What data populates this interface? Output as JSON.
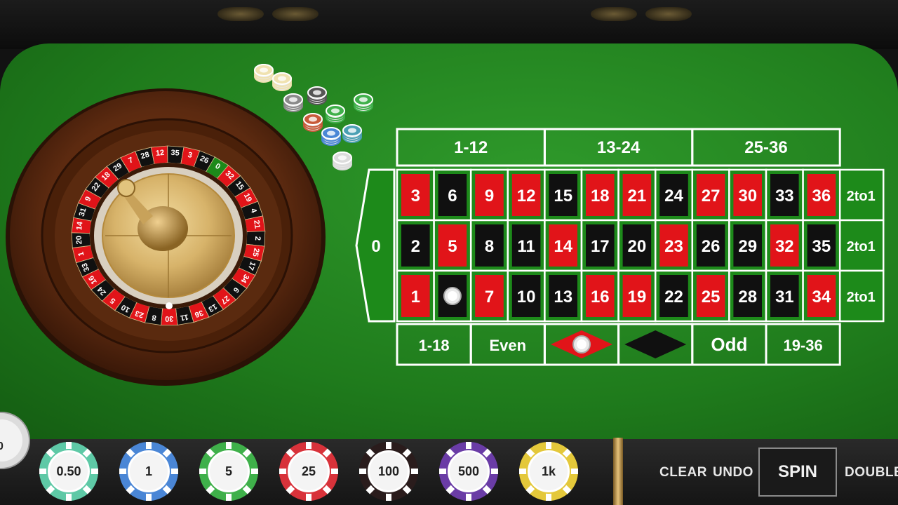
{
  "table": {
    "dozens": [
      "1-12",
      "13-24",
      "25-36"
    ],
    "zero": "0",
    "rows": [
      [
        {
          "n": "3",
          "c": "red"
        },
        {
          "n": "6",
          "c": "black"
        },
        {
          "n": "9",
          "c": "red"
        },
        {
          "n": "12",
          "c": "red"
        },
        {
          "n": "15",
          "c": "black"
        },
        {
          "n": "18",
          "c": "red"
        },
        {
          "n": "21",
          "c": "red"
        },
        {
          "n": "24",
          "c": "black"
        },
        {
          "n": "27",
          "c": "red"
        },
        {
          "n": "30",
          "c": "red"
        },
        {
          "n": "33",
          "c": "black"
        },
        {
          "n": "36",
          "c": "red"
        }
      ],
      [
        {
          "n": "2",
          "c": "black"
        },
        {
          "n": "5",
          "c": "red"
        },
        {
          "n": "8",
          "c": "black"
        },
        {
          "n": "11",
          "c": "black"
        },
        {
          "n": "14",
          "c": "red"
        },
        {
          "n": "17",
          "c": "black"
        },
        {
          "n": "20",
          "c": "black"
        },
        {
          "n": "23",
          "c": "red"
        },
        {
          "n": "26",
          "c": "black"
        },
        {
          "n": "29",
          "c": "black"
        },
        {
          "n": "32",
          "c": "red"
        },
        {
          "n": "35",
          "c": "black"
        }
      ],
      [
        {
          "n": "1",
          "c": "red"
        },
        {
          "n": "",
          "c": "black",
          "chip": true
        },
        {
          "n": "7",
          "c": "red"
        },
        {
          "n": "10",
          "c": "black"
        },
        {
          "n": "13",
          "c": "black"
        },
        {
          "n": "16",
          "c": "red"
        },
        {
          "n": "19",
          "c": "red"
        },
        {
          "n": "22",
          "c": "black"
        },
        {
          "n": "25",
          "c": "red"
        },
        {
          "n": "28",
          "c": "black"
        },
        {
          "n": "31",
          "c": "black"
        },
        {
          "n": "34",
          "c": "red"
        }
      ]
    ],
    "column_bets": [
      "2to1",
      "2to1",
      "2to1"
    ],
    "outside": [
      {
        "type": "text",
        "label": "1-18"
      },
      {
        "type": "text",
        "label": "Even"
      },
      {
        "type": "red-diamond",
        "label": "",
        "chip": true
      },
      {
        "type": "black-diamond",
        "label": ""
      },
      {
        "type": "text",
        "label": "Odd"
      },
      {
        "type": "text",
        "label": "19-36"
      }
    ]
  },
  "wheel": {
    "sequence": [
      "0",
      "32",
      "15",
      "19",
      "4",
      "21",
      "2",
      "25",
      "17",
      "34",
      "6",
      "27",
      "13",
      "36",
      "11",
      "30",
      "8",
      "23",
      "10",
      "5",
      "24",
      "16",
      "33",
      "1",
      "20",
      "14",
      "31",
      "9",
      "22",
      "18",
      "29",
      "7",
      "28",
      "12",
      "35",
      "3",
      "26"
    ]
  },
  "chips": [
    {
      "label": "0.50",
      "color": "#5ec9a6"
    },
    {
      "label": "1",
      "color": "#4a86d6"
    },
    {
      "label": "5",
      "color": "#3fb04a"
    },
    {
      "label": "25",
      "color": "#d8323a"
    },
    {
      "label": "100",
      "color": "#2a1c1c"
    },
    {
      "label": "500",
      "color": "#6a3ca6"
    },
    {
      "label": "1k",
      "color": "#e4c83a"
    }
  ],
  "partial_chip": {
    "label": "0"
  },
  "controls": {
    "clear": "CLEAR",
    "undo": "UNDO",
    "spin": "SPIN",
    "double": "DOUBLE"
  },
  "colors": {
    "felt": "#23851f",
    "red": "#e11419",
    "black": "#101010",
    "line": "#ffffff"
  }
}
